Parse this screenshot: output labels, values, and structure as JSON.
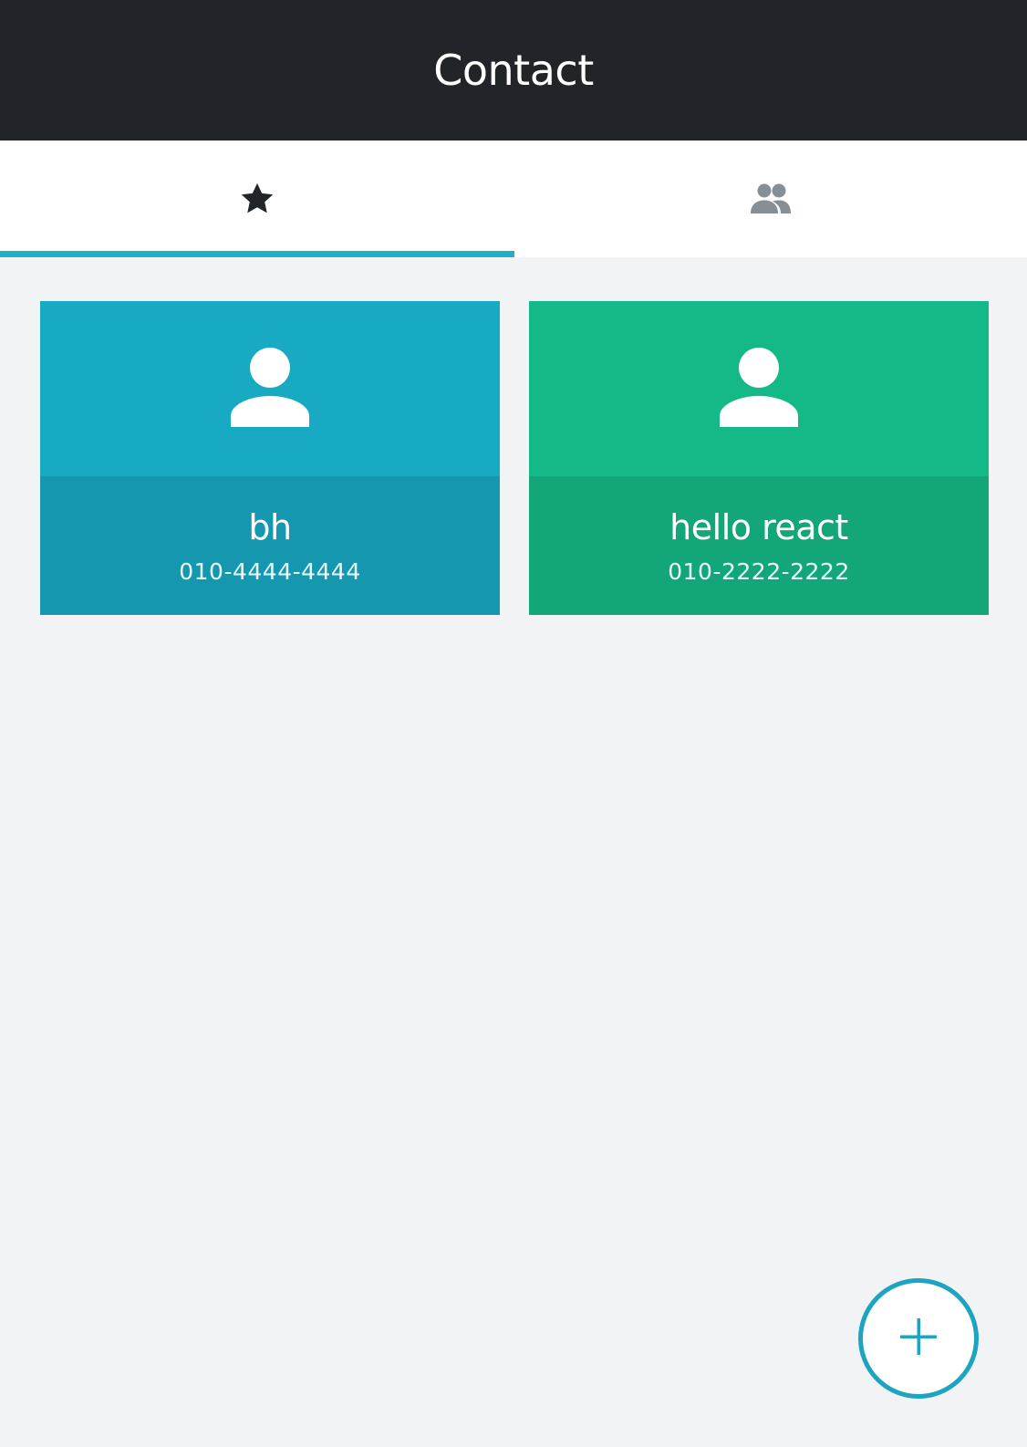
{
  "header": {
    "title": "Contact"
  },
  "tabs": [
    {
      "icon": "star-icon",
      "active": true,
      "color": "#212529"
    },
    {
      "icon": "people-icon",
      "active": false,
      "color": "#868e96"
    }
  ],
  "accent_color": "#1fb0c9",
  "contacts": [
    {
      "name": "bh",
      "phone": "010-4444-4444",
      "icon": "person-icon",
      "color_top": "#17aac2",
      "color_bottom": "#1598af"
    },
    {
      "name": "hello react",
      "phone": "010-2222-2222",
      "icon": "person-icon",
      "color_top": "#14b987",
      "color_bottom": "#12a679"
    }
  ],
  "fab": {
    "icon": "plus-icon",
    "color": "#1ca4c0"
  }
}
